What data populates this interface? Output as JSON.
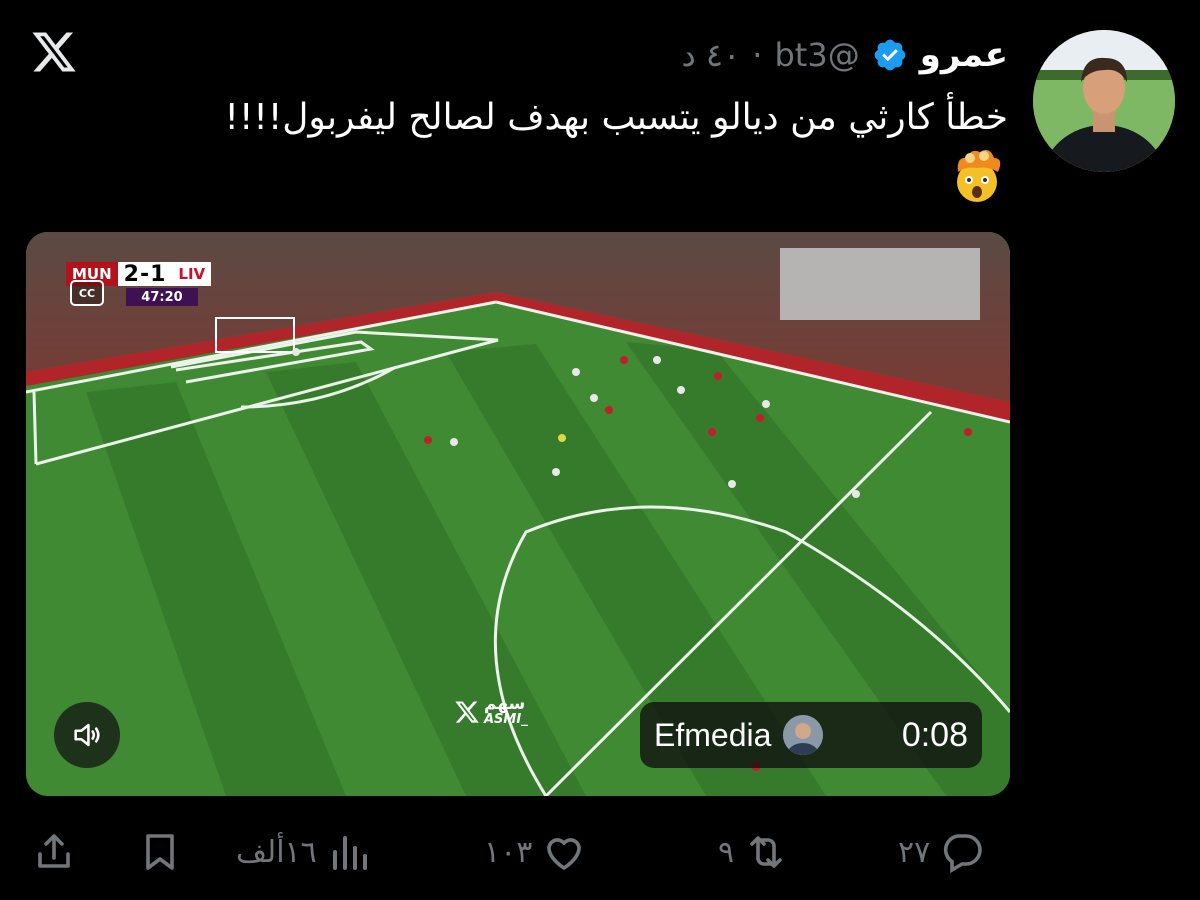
{
  "author": {
    "name": "عمرو",
    "handle": "@bt3",
    "separator": "·",
    "time": "٤٠ د"
  },
  "tweet": {
    "text": "خطأ كارثي من ديالو يتسبب بهدف لصالح ليفربول!!!!",
    "emoji": "exploding-head-emoji"
  },
  "video": {
    "scorebug": {
      "home": "MUN",
      "score": "2-1",
      "away": "LIV",
      "clock": "47:20"
    },
    "cc_label": "CC",
    "watermark": {
      "arabic": "سهم",
      "latin": "ASMI_"
    },
    "attribution": {
      "name": "Efmedia",
      "elapsed": "0:08"
    }
  },
  "actions": {
    "replies": "٢٧",
    "reposts": "٩",
    "likes": "١٠٣",
    "views": "١٦ألف"
  },
  "colors": {
    "background": "#000000",
    "text_primary": "#ffffff",
    "text_secondary": "#71767b",
    "verified": "#1d9bf0",
    "pitch": "#3b7a2e"
  },
  "icons": [
    "x-logo-icon",
    "verified-badge-icon",
    "mute-icon",
    "reply-icon",
    "repost-icon",
    "like-icon",
    "views-icon",
    "bookmark-icon",
    "share-icon"
  ]
}
